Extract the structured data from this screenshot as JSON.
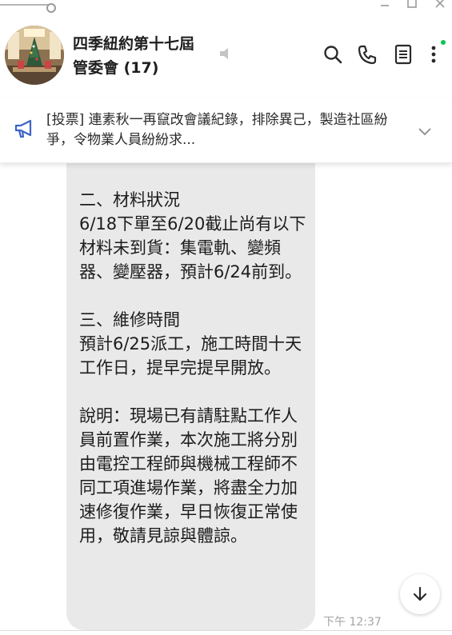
{
  "header": {
    "chat_name_line1": "四季紐約第十七屆",
    "chat_name_line2": "管委會 (17)"
  },
  "announcement": {
    "text": "[投票] 連素秋一再竄改會議紀錄，排除異己，製造社區紛爭，令物業人員紛紛求..."
  },
  "message": {
    "text": "二、材料狀況\n6/18下單至6/20截止尚有以下材料未到貨：集電軌、變頻器、變壓器，預計6/24前到。\n\n三、維修時間\n預計6/25派工，施工時間十天工作日，提早完提早開放。\n\n說明：現場已有請駐點工作人員前置作業，本次施工將分別由電控工程師與機械工程師不同工項進場作業，將盡全力加速修復作業，早日恢復正常使用，敬請見諒與體諒。",
    "time": "下午 12:37"
  },
  "icons": {
    "mute": "speaker-muted-icon",
    "search": "search-icon",
    "call": "phone-icon",
    "notes": "notes-icon",
    "more": "more-vertical-icon",
    "announce": "megaphone-icon",
    "expand": "chevron-down-icon",
    "scroll": "arrow-down-icon"
  },
  "colors": {
    "accent": "#3d63c6",
    "online": "#06c755",
    "bubble": "#e9e9e9"
  }
}
